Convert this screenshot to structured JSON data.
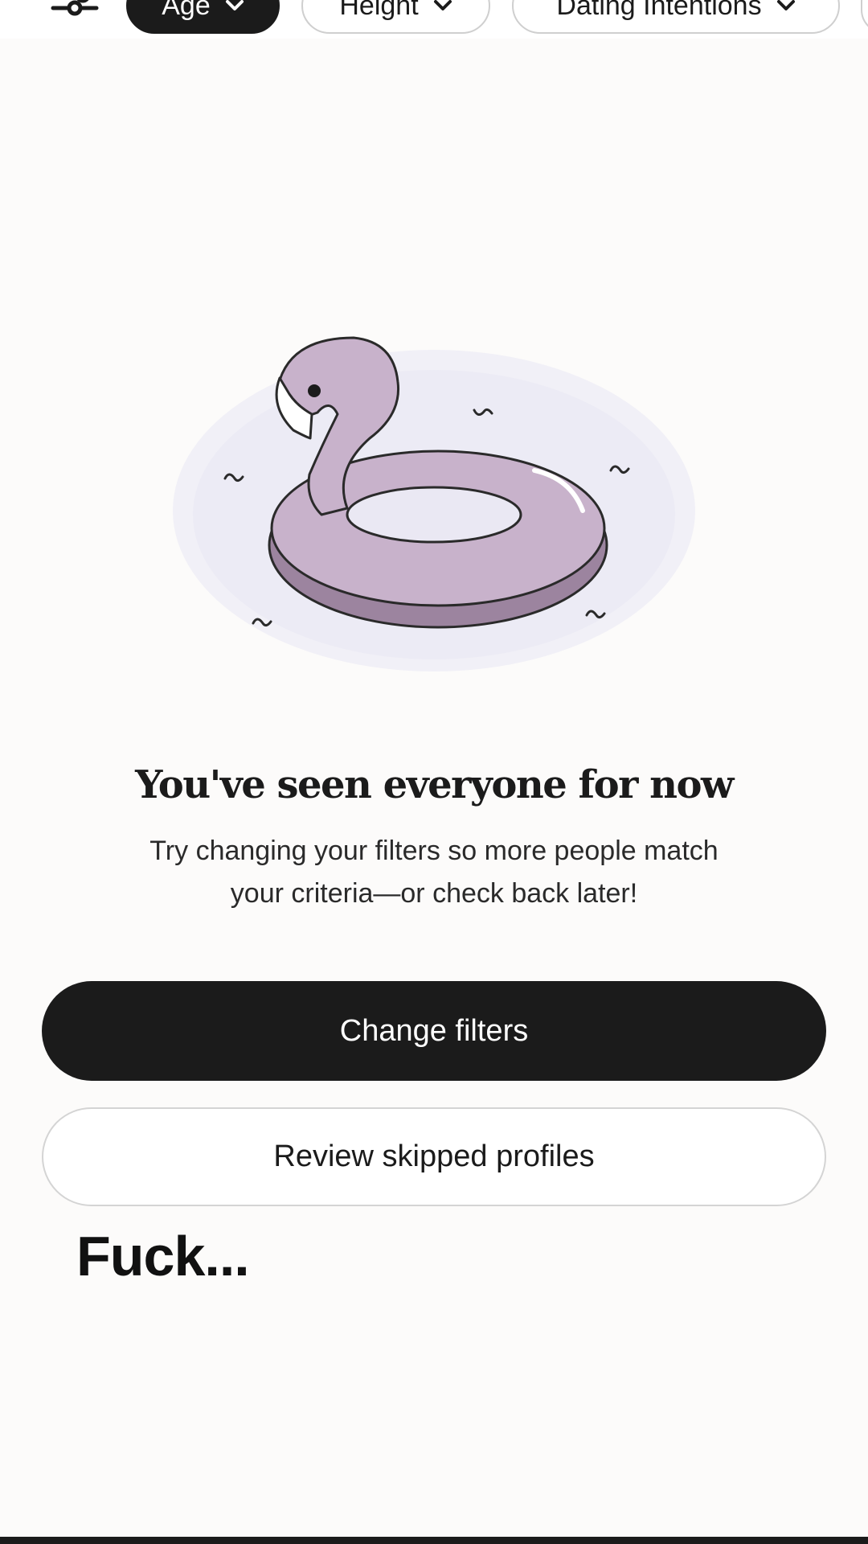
{
  "filter_bar": {
    "chips": [
      {
        "label": "Age",
        "active": true
      },
      {
        "label": "Height",
        "active": false
      },
      {
        "label": "Dating Intentions",
        "active": false
      }
    ]
  },
  "empty_state": {
    "illustration_icon": "flamingo-pool-float-illustration",
    "title": "You've seen everyone for now",
    "message_line1": "Try changing your filters so more people match",
    "message_line2": "your criteria—or check back later!"
  },
  "actions": {
    "primary_label": "Change filters",
    "secondary_label": "Review skipped profiles"
  },
  "overlay_caption": "Fuck...",
  "colors": {
    "background": "#fcfbfa",
    "primary_button": "#1b1b1b",
    "flamingo": "#c8b2cb",
    "flamingo_shadow": "#9c849f",
    "water": "#e9e7f3"
  }
}
